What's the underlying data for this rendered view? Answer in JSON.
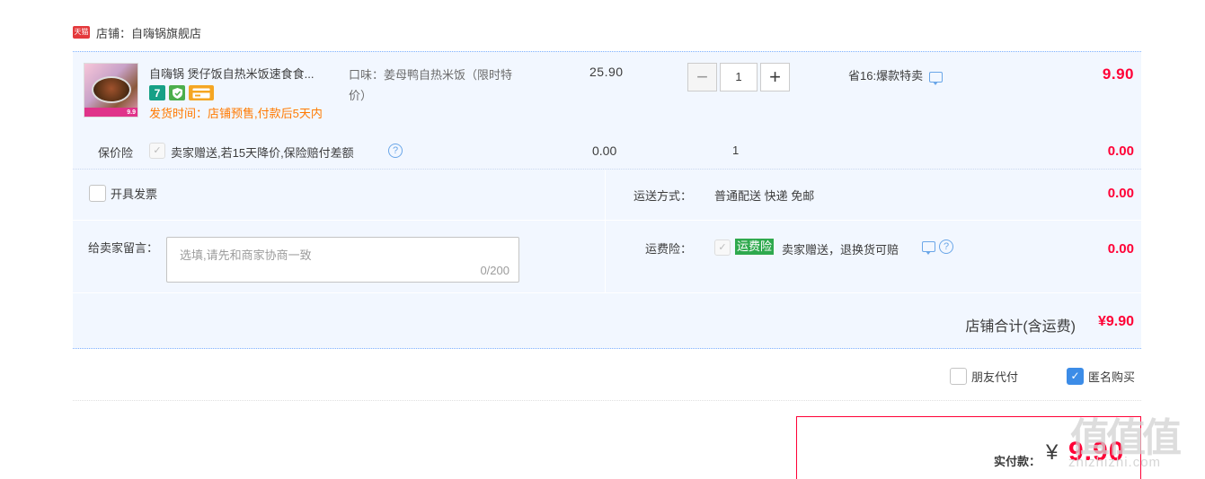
{
  "shop": {
    "badge_text": "天猫",
    "label": "店铺：自嗨锅旗舰店"
  },
  "item": {
    "thumb_price": "9.9",
    "title": "自嗨锅 煲仔饭自热米饭速食食...",
    "ship_time": "发货时间：店铺预售,付款后5天内",
    "spec_line1": "口味：姜母鸭自热米饭（限时特",
    "spec_line2": "价）",
    "unit_price": "25.90",
    "qty_minus": "−",
    "qty_value": "1",
    "qty_plus": "+",
    "promo": "省16:爆款特卖",
    "total": "9.90"
  },
  "price_insurance": {
    "label": "保价险",
    "desc": "卖家赠送,若15天降价,保险赔付差额",
    "price": "0.00",
    "qty": "1",
    "total": "0.00"
  },
  "invoice": {
    "label": "开具发票"
  },
  "shipping": {
    "label": "运送方式：",
    "value": "普通配送 快递 免邮",
    "total": "0.00"
  },
  "message": {
    "label": "给卖家留言：",
    "placeholder": "选填,请先和商家协商一致",
    "count": "0/200"
  },
  "freight_insurance": {
    "label": "运费险：",
    "tag": "运费险",
    "desc": "卖家赠送，退换货可赔",
    "total": "0.00"
  },
  "subtotal": {
    "label": "店铺合计(含运费)",
    "value": "¥9.90"
  },
  "options": {
    "friend_pay": "朋友代付",
    "anonymous": "匿名购买"
  },
  "payment": {
    "label": "实付款：",
    "currency": "¥",
    "value": "9.90"
  },
  "watermark": {
    "glyphs": "值值值",
    "text": "zhizhizhi.com"
  },
  "colors": {
    "accent_red": "#ff0036",
    "panel_bg": "#f2f7ff",
    "ship_orange": "#ff7a00",
    "check_blue": "#3c8ce7"
  }
}
